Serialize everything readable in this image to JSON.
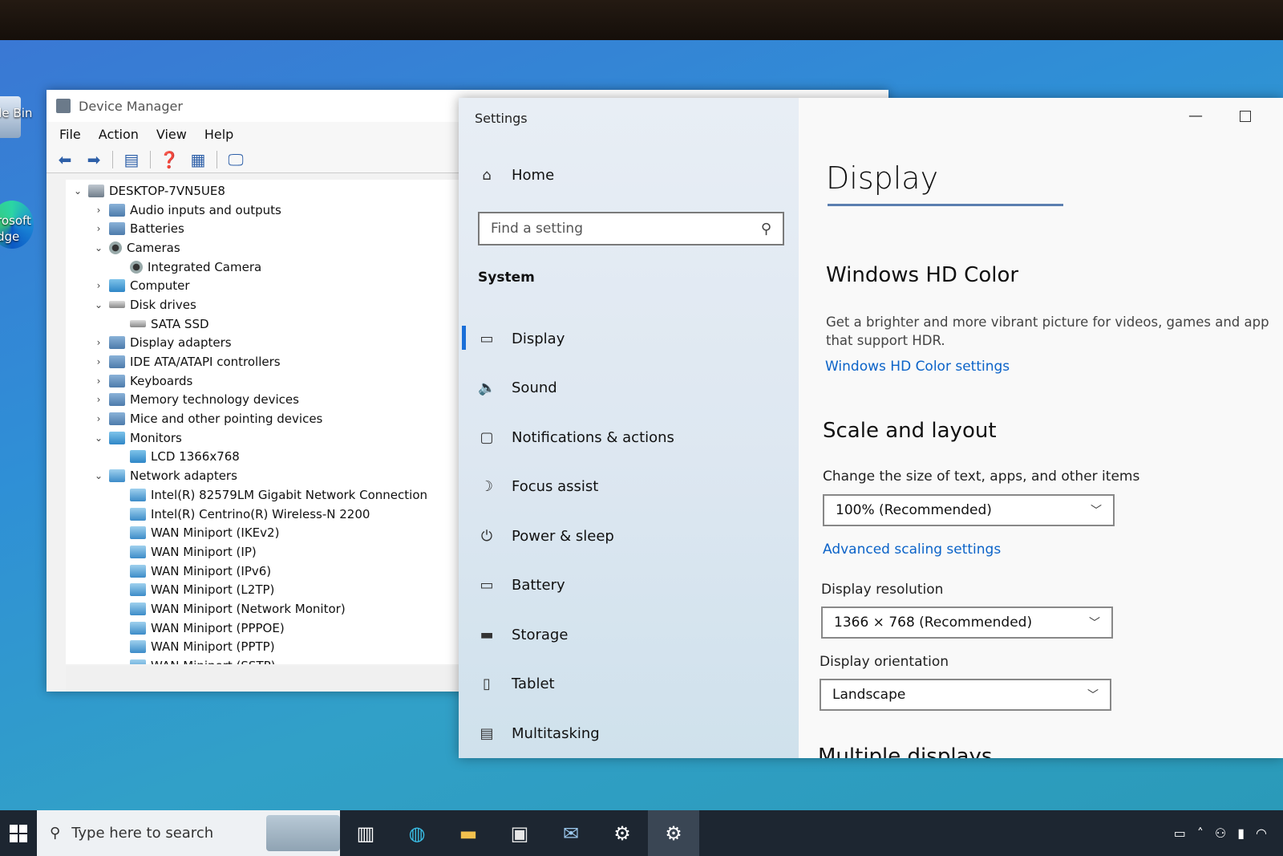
{
  "desktop": {
    "recycle_bin_label": "cle Bin",
    "edge_label_1": "rosoft",
    "edge_label_2": "dge"
  },
  "device_manager": {
    "title": "Device Manager",
    "menu": [
      "File",
      "Action",
      "View",
      "Help"
    ],
    "tree": [
      {
        "label": "DESKTOP-7VN5UE8",
        "level": 0,
        "expanded": true,
        "icon": "computer-icon"
      },
      {
        "label": "Audio inputs and outputs",
        "level": 1,
        "expanded": false,
        "icon": "audio-icon"
      },
      {
        "label": "Batteries",
        "level": 1,
        "expanded": false,
        "icon": "battery-icon"
      },
      {
        "label": "Cameras",
        "level": 1,
        "expanded": true,
        "icon": "camera-icon"
      },
      {
        "label": "Integrated Camera",
        "level": 2,
        "icon": "camera-icon"
      },
      {
        "label": "Computer",
        "level": 1,
        "expanded": false,
        "icon": "monitor-icon"
      },
      {
        "label": "Disk drives",
        "level": 1,
        "expanded": true,
        "icon": "disk-icon"
      },
      {
        "label": "SATA SSD",
        "level": 2,
        "icon": "disk-icon"
      },
      {
        "label": "Display adapters",
        "level": 1,
        "expanded": false,
        "icon": "display-adapter-icon"
      },
      {
        "label": "IDE ATA/ATAPI controllers",
        "level": 1,
        "expanded": false,
        "icon": "controller-icon"
      },
      {
        "label": "Keyboards",
        "level": 1,
        "expanded": false,
        "icon": "keyboard-icon"
      },
      {
        "label": "Memory technology devices",
        "level": 1,
        "expanded": false,
        "icon": "memory-icon"
      },
      {
        "label": "Mice and other pointing devices",
        "level": 1,
        "expanded": false,
        "icon": "mouse-icon"
      },
      {
        "label": "Monitors",
        "level": 1,
        "expanded": true,
        "icon": "monitor-icon"
      },
      {
        "label": "LCD 1366x768",
        "level": 2,
        "icon": "monitor-icon"
      },
      {
        "label": "Network adapters",
        "level": 1,
        "expanded": true,
        "icon": "network-icon"
      },
      {
        "label": "Intel(R) 82579LM Gigabit Network Connection",
        "level": 2,
        "icon": "network-icon"
      },
      {
        "label": "Intel(R) Centrino(R) Wireless-N 2200",
        "level": 2,
        "icon": "network-icon"
      },
      {
        "label": "WAN Miniport (IKEv2)",
        "level": 2,
        "icon": "network-icon"
      },
      {
        "label": "WAN Miniport (IP)",
        "level": 2,
        "icon": "network-icon"
      },
      {
        "label": "WAN Miniport (IPv6)",
        "level": 2,
        "icon": "network-icon"
      },
      {
        "label": "WAN Miniport (L2TP)",
        "level": 2,
        "icon": "network-icon"
      },
      {
        "label": "WAN Miniport (Network Monitor)",
        "level": 2,
        "icon": "network-icon"
      },
      {
        "label": "WAN Miniport (PPPOE)",
        "level": 2,
        "icon": "network-icon"
      },
      {
        "label": "WAN Miniport (PPTP)",
        "level": 2,
        "icon": "network-icon"
      },
      {
        "label": "WAN Miniport (SSTP)",
        "level": 2,
        "icon": "network-icon"
      }
    ]
  },
  "settings": {
    "window_title": "Settings",
    "nav": {
      "home": "Home",
      "search_placeholder": "Find a setting",
      "section": "System",
      "items": [
        {
          "label": "Display",
          "icon": "display-icon",
          "selected": true
        },
        {
          "label": "Sound",
          "icon": "speaker-icon"
        },
        {
          "label": "Notifications & actions",
          "icon": "notification-icon"
        },
        {
          "label": "Focus assist",
          "icon": "moon-icon"
        },
        {
          "label": "Power & sleep",
          "icon": "power-icon"
        },
        {
          "label": "Battery",
          "icon": "battery-icon"
        },
        {
          "label": "Storage",
          "icon": "storage-icon"
        },
        {
          "label": "Tablet",
          "icon": "tablet-icon"
        },
        {
          "label": "Multitasking",
          "icon": "multitasking-icon"
        }
      ]
    },
    "main": {
      "title": "Display",
      "hd_color": {
        "heading": "Windows HD Color",
        "description_1": "Get a brighter and more vibrant picture for videos, games and app",
        "description_2": "that support HDR.",
        "link": "Windows HD Color settings"
      },
      "scale": {
        "heading": "Scale and layout",
        "size_label": "Change the size of text, apps, and other items",
        "size_value": "100% (Recommended)",
        "advanced_link": "Advanced scaling settings",
        "resolution_label": "Display resolution",
        "resolution_value": "1366 × 768 (Recommended)",
        "orientation_label": "Display orientation",
        "orientation_value": "Landscape"
      },
      "cut_heading": "Multiple displays"
    }
  },
  "taskbar": {
    "search_placeholder": "Type here to search"
  },
  "colors": {
    "accent": "#1a6fd8",
    "link": "#0b63c8",
    "taskbar": "#1d2631"
  }
}
